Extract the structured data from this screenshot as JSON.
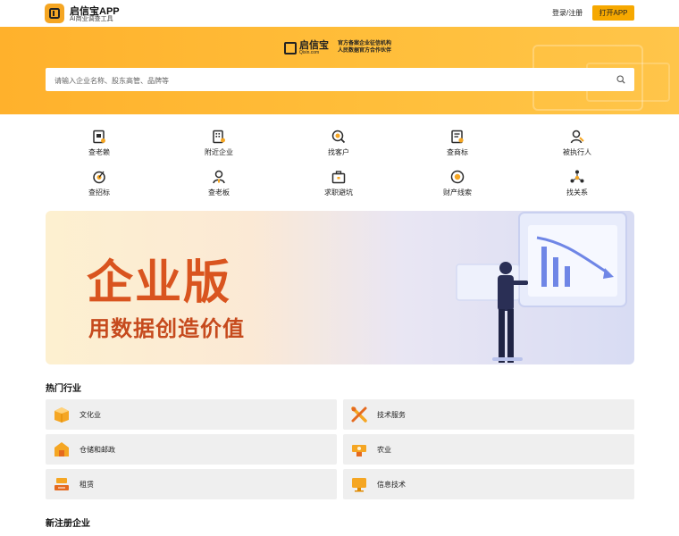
{
  "header": {
    "app_name": "启信宝APP",
    "app_subtitle": "AI商业调查工具",
    "login_label": "登录/注册",
    "open_app_label": "打开APP"
  },
  "hero": {
    "brand_name": "启信宝",
    "brand_domain": "Qixin.com",
    "tagline_1": "官方备案企业征信机构",
    "tagline_2": "人民数据官方合作伙伴",
    "search_placeholder": "请输入企业名称、股东高管、品牌等"
  },
  "quick_links": [
    {
      "label": "查老赖",
      "icon": "debtor-doc-icon"
    },
    {
      "label": "附近企业",
      "icon": "nearby-building-icon"
    },
    {
      "label": "找客户",
      "icon": "find-customer-icon"
    },
    {
      "label": "查商标",
      "icon": "trademark-icon"
    },
    {
      "label": "被执行人",
      "icon": "executed-person-icon"
    },
    {
      "label": "查招标",
      "icon": "bidding-icon"
    },
    {
      "label": "查老板",
      "icon": "boss-icon"
    },
    {
      "label": "求职避坑",
      "icon": "briefcase-icon"
    },
    {
      "label": "财产线索",
      "icon": "property-clue-icon"
    },
    {
      "label": "找关系",
      "icon": "relation-icon"
    }
  ],
  "banner": {
    "title": "企业版",
    "subtitle": "用数据创造价值"
  },
  "hot_industries": {
    "title": "热门行业",
    "items": [
      {
        "label": "文化业",
        "icon": "culture-icon"
      },
      {
        "label": "技术服务",
        "icon": "tech-service-icon"
      },
      {
        "label": "仓储和邮政",
        "icon": "warehouse-icon"
      },
      {
        "label": "农业",
        "icon": "agriculture-icon"
      },
      {
        "label": "租赁",
        "icon": "leasing-icon"
      },
      {
        "label": "信息技术",
        "icon": "it-icon"
      }
    ]
  },
  "new_companies": {
    "title": "新注册企业"
  },
  "colors": {
    "accent": "#f6a800",
    "hero_bg": "#ffb830",
    "banner_text": "#d9541f",
    "icon_dark": "#2b2b2b",
    "icon_orange": "#f5a623",
    "card_bg": "#efefef"
  }
}
